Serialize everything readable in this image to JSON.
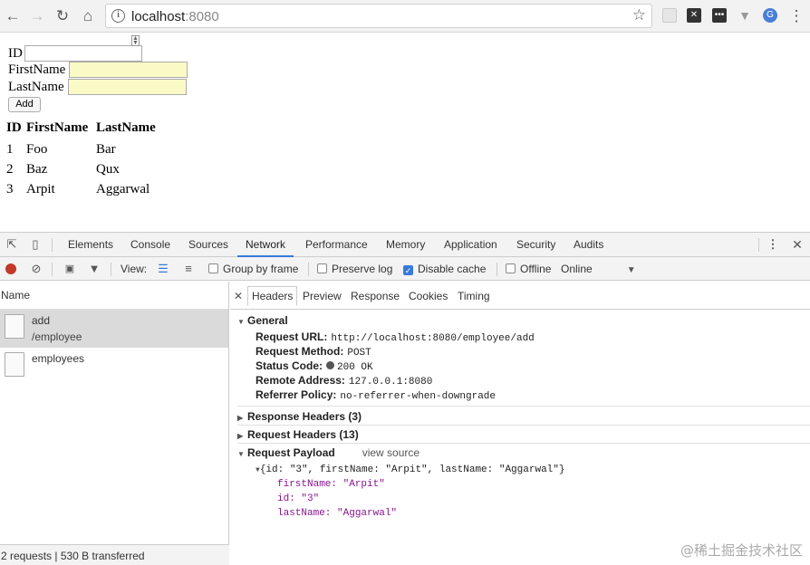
{
  "browser": {
    "url_host": "localhost",
    "url_port": ":8080"
  },
  "form": {
    "id_label": "ID",
    "first_label": "FirstName",
    "last_label": "LastName",
    "add_label": "Add"
  },
  "table": {
    "headers": [
      "ID",
      "FirstName",
      "LastName"
    ],
    "rows": [
      [
        "1",
        "Foo",
        "Bar"
      ],
      [
        "2",
        "Baz",
        "Qux"
      ],
      [
        "3",
        "Arpit",
        "Aggarwal"
      ]
    ]
  },
  "devtools": {
    "tabs": [
      "Elements",
      "Console",
      "Sources",
      "Network",
      "Performance",
      "Memory",
      "Application",
      "Security",
      "Audits"
    ],
    "toolbar": {
      "view_label": "View:",
      "group_by_frame": "Group by frame",
      "preserve_log": "Preserve log",
      "disable_cache": "Disable cache",
      "offline": "Offline",
      "throttle": "Online"
    },
    "name_header": "Name",
    "requests": [
      {
        "name": "add",
        "path": "/employee"
      },
      {
        "name": "employees",
        "path": ""
      }
    ],
    "footer": "2 requests | 530 B transferred",
    "detail_tabs": [
      "Headers",
      "Preview",
      "Response",
      "Cookies",
      "Timing"
    ],
    "general": {
      "title": "General",
      "request_url_key": "Request URL:",
      "request_url": "http://localhost:8080/employee/add",
      "method_key": "Request Method:",
      "method": "POST",
      "status_key": "Status Code:",
      "status": "200 OK",
      "remote_key": "Remote Address:",
      "remote": "127.0.0.1:8080",
      "referrer_key": "Referrer Policy:",
      "referrer": "no-referrer-when-downgrade"
    },
    "response_headers": "Response Headers (3)",
    "request_headers": "Request Headers (13)",
    "payload": {
      "title": "Request Payload",
      "view_source": "view source",
      "summary": "{id: \"3\", firstName: \"Arpit\", lastName: \"Aggarwal\"}",
      "firstName_key": "firstName:",
      "firstName_val": "\"Arpit\"",
      "id_key": "id:",
      "id_val": "\"3\"",
      "lastName_key": "lastName:",
      "lastName_val": "\"Aggarwal\""
    }
  },
  "watermark": "@稀土掘金技术社区"
}
